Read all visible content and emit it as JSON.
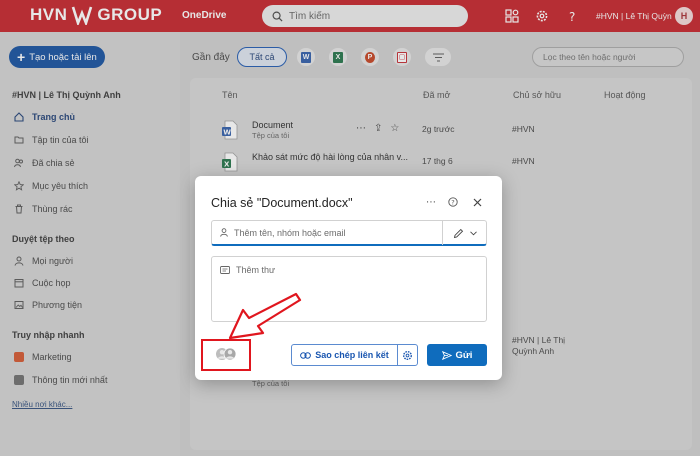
{
  "topbar": {
    "brand_left": "HVN",
    "brand_right": "GROUP",
    "app_name": "OneDrive",
    "search_placeholder": "Tìm kiếm",
    "user_label": "#HVN | Lê Thị Quỳn",
    "avatar_initial": "H"
  },
  "sidebar": {
    "create_label": "Tạo hoặc tải lên",
    "owner": "#HVN | Lê Thị Quỳnh Anh",
    "items": [
      "Trang chủ",
      "Tập tin của tôi",
      "Đã chia sẻ",
      "Mục yêu thích",
      "Thùng rác"
    ],
    "browse_heading": "Duyệt tệp theo",
    "browse_items": [
      "Mọi người",
      "Cuộc họp",
      "Phương tiện"
    ],
    "quick_heading": "Truy nhập nhanh",
    "quick_items": [
      "Marketing",
      "Thông tin mới nhất"
    ],
    "more_label": "Nhiều nơi khác..."
  },
  "main": {
    "recent_label": "Gần đây",
    "filter_all": "Tất cả",
    "filter_placeholder": "Lọc theo tên hoặc người",
    "columns": [
      "Tên",
      "Đã mở",
      "Chủ sở hữu",
      "Hoạt động"
    ],
    "rows": [
      {
        "name": "Document",
        "sub": "Tệp của tôi",
        "opened": "2g trước",
        "owner": "#HVN",
        "type": "word"
      },
      {
        "name": "Khảo sát mức độ hài lòng của nhân v...",
        "sub": "",
        "opened": "17 thg 6",
        "owner": "#HVN",
        "type": "excel"
      }
    ],
    "behind_owner_1": "#HVN | Lê Thị",
    "behind_owner_2": "Quỳnh Anh",
    "behind_sub": "Tệp của tôi"
  },
  "dialog": {
    "title": "Chia sẻ \"Document.docx\"",
    "name_placeholder": "Thêm tên, nhóm hoặc email",
    "message_placeholder": "Thêm thư",
    "copy_link_label": "Sao chép liên kết",
    "send_label": "Gửi"
  },
  "colors": {
    "topbar": "#c41e25",
    "primary": "#0f6cbd",
    "annotation": "#e0161e"
  }
}
